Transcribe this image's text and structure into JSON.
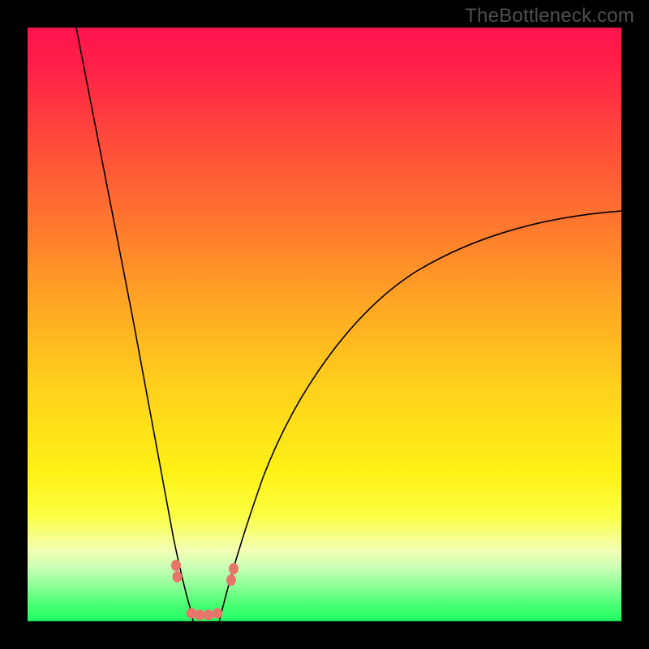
{
  "watermark": "TheBottleneck.com",
  "chart_data": {
    "type": "line",
    "title": "",
    "xlabel": "",
    "ylabel": "",
    "xlim": [
      0,
      100
    ],
    "ylim": [
      0,
      100
    ],
    "grid": false,
    "legend": false,
    "note": "Axes are implicit (no tick labels visible). x-values are positions across the plot (0–100 left→right); y-values are heights (0 at bottom, 100 at top). Values are estimated from pixel positions at the precision the image permits.",
    "series": [
      {
        "name": "curve-left-branch",
        "x": [
          8,
          10,
          12,
          14,
          16,
          18,
          20,
          22,
          24,
          26,
          27.4
        ],
        "values": [
          100,
          88,
          76,
          65,
          53,
          42,
          31,
          21,
          12,
          5,
          0
        ]
      },
      {
        "name": "curve-right-branch",
        "x": [
          32.6,
          35,
          38,
          42,
          46,
          50,
          55,
          60,
          66,
          72,
          78,
          85,
          92,
          99
        ],
        "values": [
          0,
          5,
          11,
          20,
          28,
          35,
          43,
          49,
          55,
          60,
          63,
          66,
          68,
          69
        ]
      }
    ],
    "markers": [
      {
        "name": "left-pair-top",
        "x": 25.0,
        "y": 9.5
      },
      {
        "name": "left-pair-bottom",
        "x": 25.2,
        "y": 7.5
      },
      {
        "name": "valley-a",
        "x": 27.6,
        "y": 1.4
      },
      {
        "name": "valley-b",
        "x": 29.0,
        "y": 1.1
      },
      {
        "name": "valley-c",
        "x": 30.5,
        "y": 1.1
      },
      {
        "name": "valley-d",
        "x": 32.0,
        "y": 1.4
      },
      {
        "name": "right-pair-bottom",
        "x": 34.3,
        "y": 7.0
      },
      {
        "name": "right-pair-top",
        "x": 34.7,
        "y": 9.0
      }
    ]
  }
}
